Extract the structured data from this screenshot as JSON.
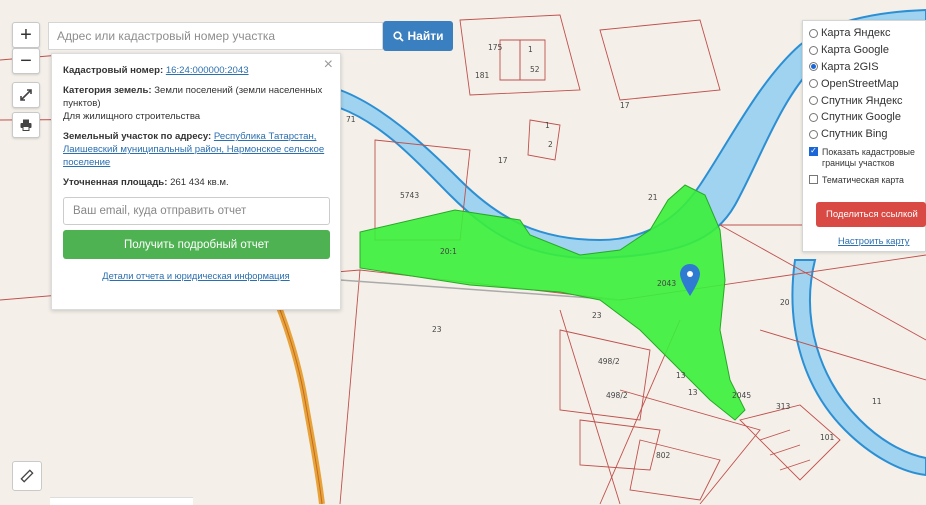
{
  "map": {
    "lot_labels": [
      "17",
      "17",
      "1",
      "5743",
      "20:1",
      "21",
      "20",
      "23",
      "23",
      "13",
      "13",
      "498/2",
      "498/2",
      "802",
      "11",
      "313",
      "2045",
      "1",
      "2043",
      "175",
      "1",
      "52",
      "101",
      "181",
      "71",
      "2"
    ]
  },
  "controls": {
    "zoom_in": "+",
    "zoom_out": "−"
  },
  "search": {
    "placeholder": "Адрес или кадастровый номер участка",
    "button_label": "Найти"
  },
  "info": {
    "cadastral_label": "Кадастровый номер:",
    "cadastral_value": "16:24:000000:2043",
    "category_label": "Категория земель:",
    "category_value": "Земли поселений (земли населенных пунктов)",
    "use_value": "Для жилищного строительства",
    "address_label": "Земельный участок по адресу:",
    "address_value": "Республика Татарстан, Лаишевский муниципальный район, Нармонское сельское поселение",
    "area_label": "Уточненная площадь:",
    "area_value": "261 434 кв.м.",
    "email_placeholder": "Ваш email, куда отправить отчет",
    "report_button": "Получить подробный отчет",
    "details_link": "Детали отчета и юридическая информация"
  },
  "layers": {
    "options": [
      {
        "label": "Карта Яндекс",
        "selected": false
      },
      {
        "label": "Карта Google",
        "selected": false
      },
      {
        "label": "Карта 2GIS",
        "selected": true
      },
      {
        "label": "OpenStreetMap",
        "selected": false
      },
      {
        "label": "Спутник Яндекс",
        "selected": false
      },
      {
        "label": "Спутник Google",
        "selected": false
      },
      {
        "label": "Спутник Bing",
        "selected": false
      }
    ],
    "show_cadastral_label": "Показать кадастровые границы участков",
    "show_cadastral_checked": true,
    "thematic_label": "Тематическая карта",
    "thematic_checked": false,
    "share_button": "Поделиться ссылкой",
    "setup_link": "Настроить карту"
  },
  "colors": {
    "parcel_fill": "#3af03a",
    "water": "#9fd3ef",
    "river_bank": "#2c8fd3",
    "road": "#e7a33a",
    "boundary": "#c0504d",
    "search_button": "#3a7fbf",
    "report_button": "#4fb252",
    "share_button": "#d94a44"
  }
}
